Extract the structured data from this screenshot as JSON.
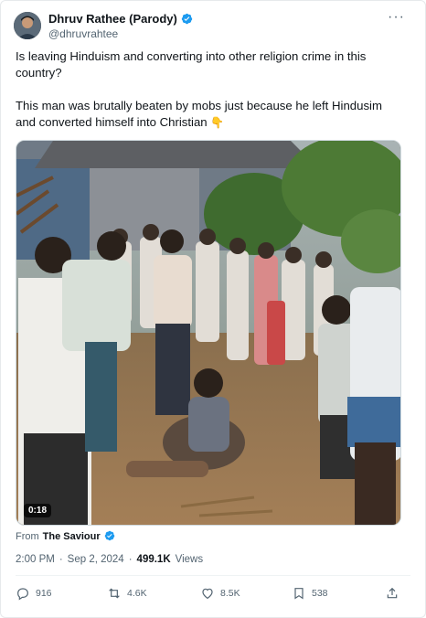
{
  "author": {
    "display_name": "Dhruv Rathee (Parody)",
    "handle": "@dhruvrahtee",
    "verified": true
  },
  "tweet": {
    "paragraph1": "Is leaving Hinduism and converting into other religion crime in this country?",
    "paragraph2": "This man was brutally beaten by mobs just because he left Hindusim and converted himself into Christian",
    "emoji": "👇"
  },
  "media": {
    "duration": "0:18"
  },
  "source": {
    "prefix": "From",
    "name": "The Saviour"
  },
  "meta": {
    "time": "2:00 PM",
    "separator": "·",
    "date": "Sep 2, 2024",
    "views_count": "499.1K",
    "views_label": "Views"
  },
  "actions": {
    "replies": "916",
    "reposts": "4.6K",
    "likes": "8.5K",
    "bookmarks": "538"
  },
  "colors": {
    "verified_blue": "#1d9bf0",
    "muted_text": "#536471",
    "primary_text": "#0f1419"
  }
}
